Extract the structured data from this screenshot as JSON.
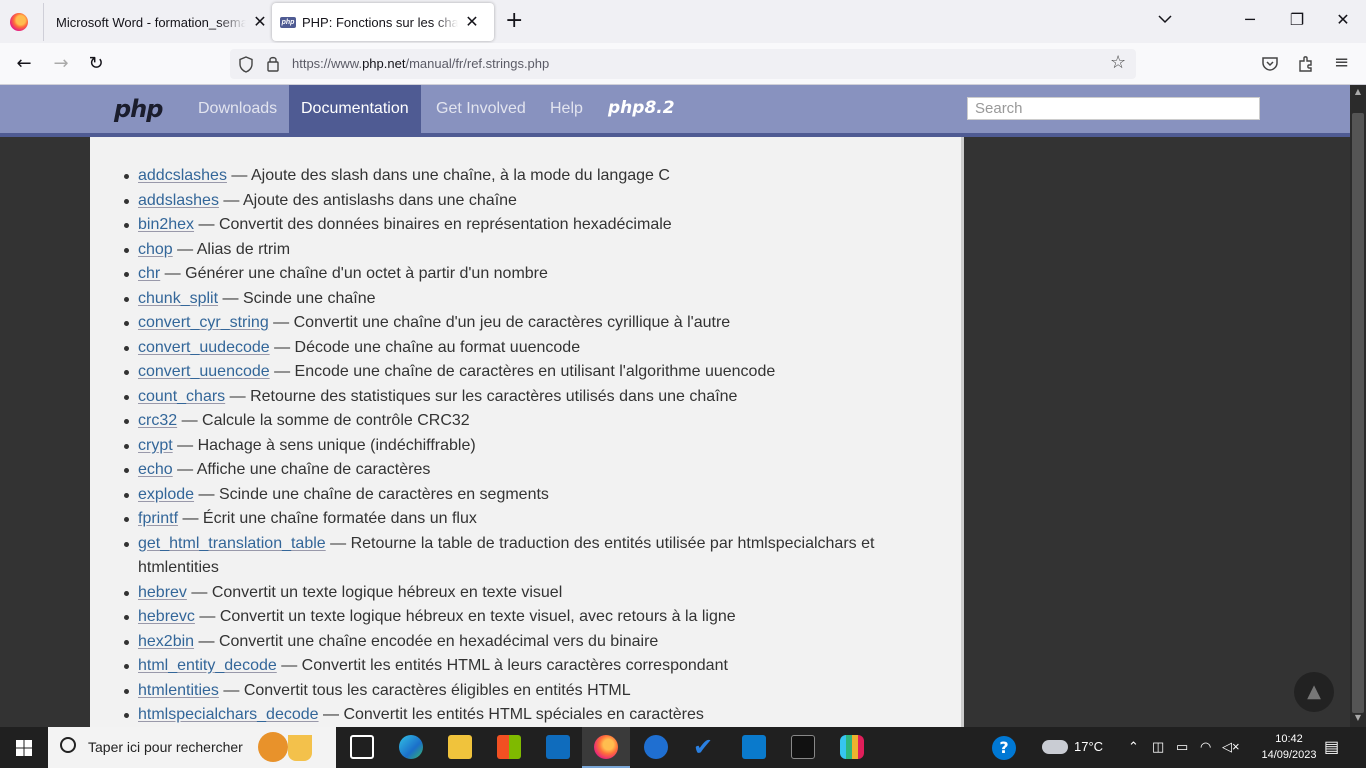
{
  "browser": {
    "tabs": [
      {
        "title": "Microsoft Word - formation_semaine",
        "close": "✕"
      },
      {
        "title": "PHP: Fonctions sur les chaînes de caractères",
        "close": "✕",
        "favicon": "php"
      }
    ],
    "new_tab": "+",
    "url_prefix": "https://www.",
    "url_domain": "php.net",
    "url_path": "/manual/fr/ref.strings.php"
  },
  "php_header": {
    "logo": "php",
    "nav": [
      "Downloads",
      "Documentation",
      "Get Involved",
      "Help"
    ],
    "active": "Documentation",
    "banner": "php8.2",
    "search_placeholder": "Search"
  },
  "functions": [
    {
      "name": "addcslashes",
      "desc": " — Ajoute des slash dans une chaîne, à la mode du langage C"
    },
    {
      "name": "addslashes",
      "desc": " — Ajoute des antislashs dans une chaîne"
    },
    {
      "name": "bin2hex",
      "desc": " — Convertit des données binaires en représentation hexadécimale"
    },
    {
      "name": "chop",
      "desc": " — Alias de rtrim"
    },
    {
      "name": "chr",
      "desc": " — Générer une chaîne d'un octet à partir d'un nombre"
    },
    {
      "name": "chunk_split",
      "desc": " — Scinde une chaîne"
    },
    {
      "name": "convert_cyr_string",
      "desc": " — Convertit une chaîne d'un jeu de caractères cyrillique à l'autre"
    },
    {
      "name": "convert_uudecode",
      "desc": " — Décode une chaîne au format uuencode"
    },
    {
      "name": "convert_uuencode",
      "desc": " — Encode une chaîne de caractères en utilisant l'algorithme uuencode"
    },
    {
      "name": "count_chars",
      "desc": " — Retourne des statistiques sur les caractères utilisés dans une chaîne"
    },
    {
      "name": "crc32",
      "desc": " — Calcule la somme de contrôle CRC32"
    },
    {
      "name": "crypt",
      "desc": " — Hachage à sens unique (indéchiffrable)"
    },
    {
      "name": "echo",
      "desc": " — Affiche une chaîne de caractères"
    },
    {
      "name": "explode",
      "desc": " — Scinde une chaîne de caractères en segments"
    },
    {
      "name": "fprintf",
      "desc": " — Écrit une chaîne formatée dans un flux"
    },
    {
      "name": "get_html_translation_table",
      "desc": " — Retourne la table de traduction des entités utilisée par htmlspecialchars et htmlentities"
    },
    {
      "name": "hebrev",
      "desc": " — Convertit un texte logique hébreux en texte visuel"
    },
    {
      "name": "hebrevc",
      "desc": " — Convertit un texte logique hébreux en texte visuel, avec retours à la ligne"
    },
    {
      "name": "hex2bin",
      "desc": " — Convertit une chaîne encodée en hexadécimal vers du binaire"
    },
    {
      "name": "html_entity_decode",
      "desc": " — Convertit les entités HTML à leurs caractères correspondant"
    },
    {
      "name": "htmlentities",
      "desc": " — Convertit tous les caractères éligibles en entités HTML"
    },
    {
      "name": "htmlspecialchars_decode",
      "desc": " — Convertit les entités HTML spéciales en caractères"
    }
  ],
  "taskbar": {
    "search_text": "Taper ici pour rechercher",
    "weather": "17°C",
    "time": "10:42",
    "date": "14/09/2023"
  },
  "colors": {
    "php_header": "#8892bf",
    "php_active": "#4f5b93",
    "link": "#336699"
  }
}
